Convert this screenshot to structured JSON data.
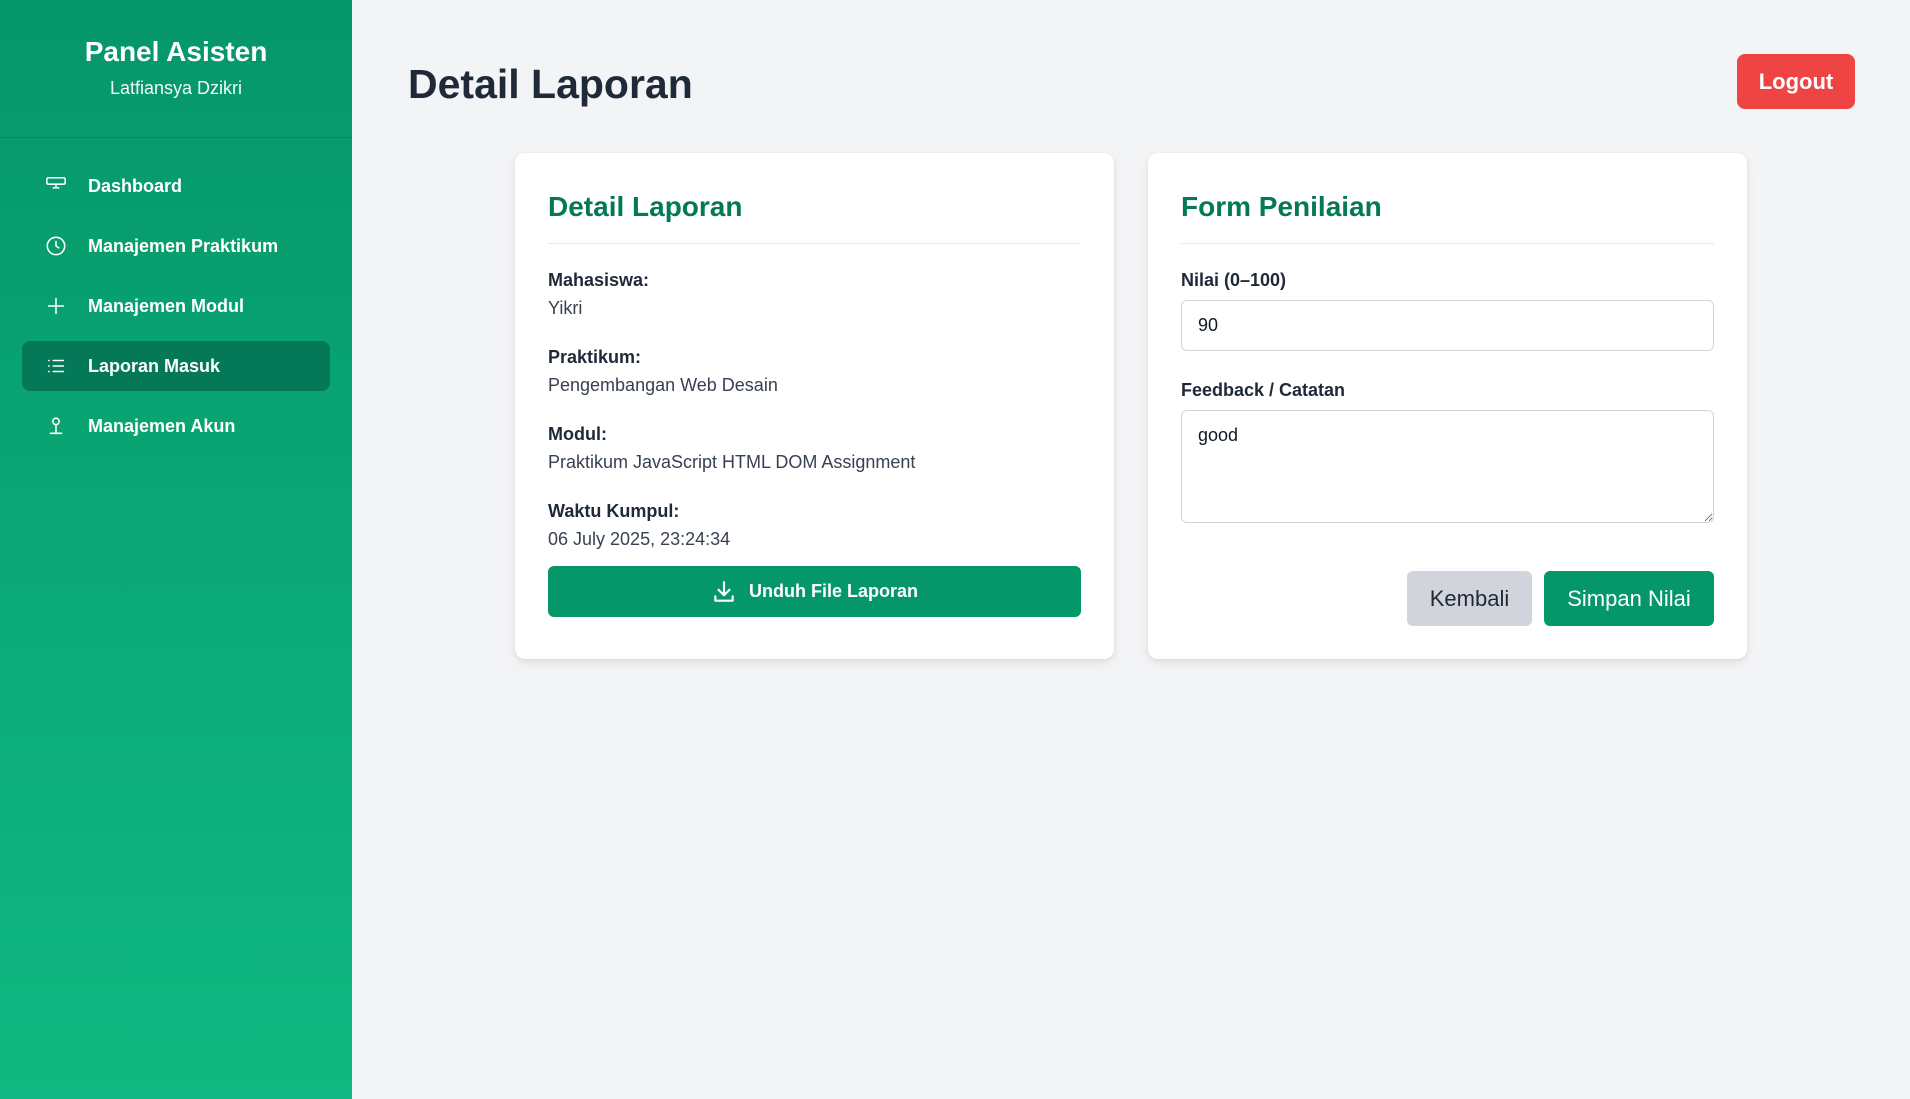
{
  "sidebar": {
    "title": "Panel Asisten",
    "user_name": "Latfiansya Dzikri",
    "items": [
      {
        "label": "Dashboard",
        "icon": "monitor-icon",
        "active": false
      },
      {
        "label": "Manajemen Praktikum",
        "icon": "clock-icon",
        "active": false
      },
      {
        "label": "Manajemen Modul",
        "icon": "plus-icon",
        "active": false
      },
      {
        "label": "Laporan Masuk",
        "icon": "list-icon",
        "active": true
      },
      {
        "label": "Manajemen Akun",
        "icon": "user-icon",
        "active": false
      }
    ]
  },
  "header": {
    "page_title": "Detail Laporan",
    "logout_label": "Logout"
  },
  "detail_card": {
    "title": "Detail Laporan",
    "fields": [
      {
        "label": "Mahasiswa:",
        "value": "Yikri"
      },
      {
        "label": "Praktikum:",
        "value": "Pengembangan Web Desain"
      },
      {
        "label": "Modul:",
        "value": "Praktikum JavaScript HTML DOM Assignment"
      },
      {
        "label": "Waktu Kumpul:",
        "value": "06 July 2025, 23:24:34"
      }
    ],
    "download_label": "Unduh File Laporan"
  },
  "form_card": {
    "title": "Form Penilaian",
    "score_label": "Nilai (0–100)",
    "score_value": "90",
    "feedback_label": "Feedback / Catatan",
    "feedback_value": "good",
    "back_label": "Kembali",
    "save_label": "Simpan Nilai"
  },
  "colors": {
    "sidebar_top": "#059669",
    "sidebar_bottom": "#10b981",
    "active_item": "#047857",
    "accent": "#059669",
    "logout": "#ef4444"
  }
}
